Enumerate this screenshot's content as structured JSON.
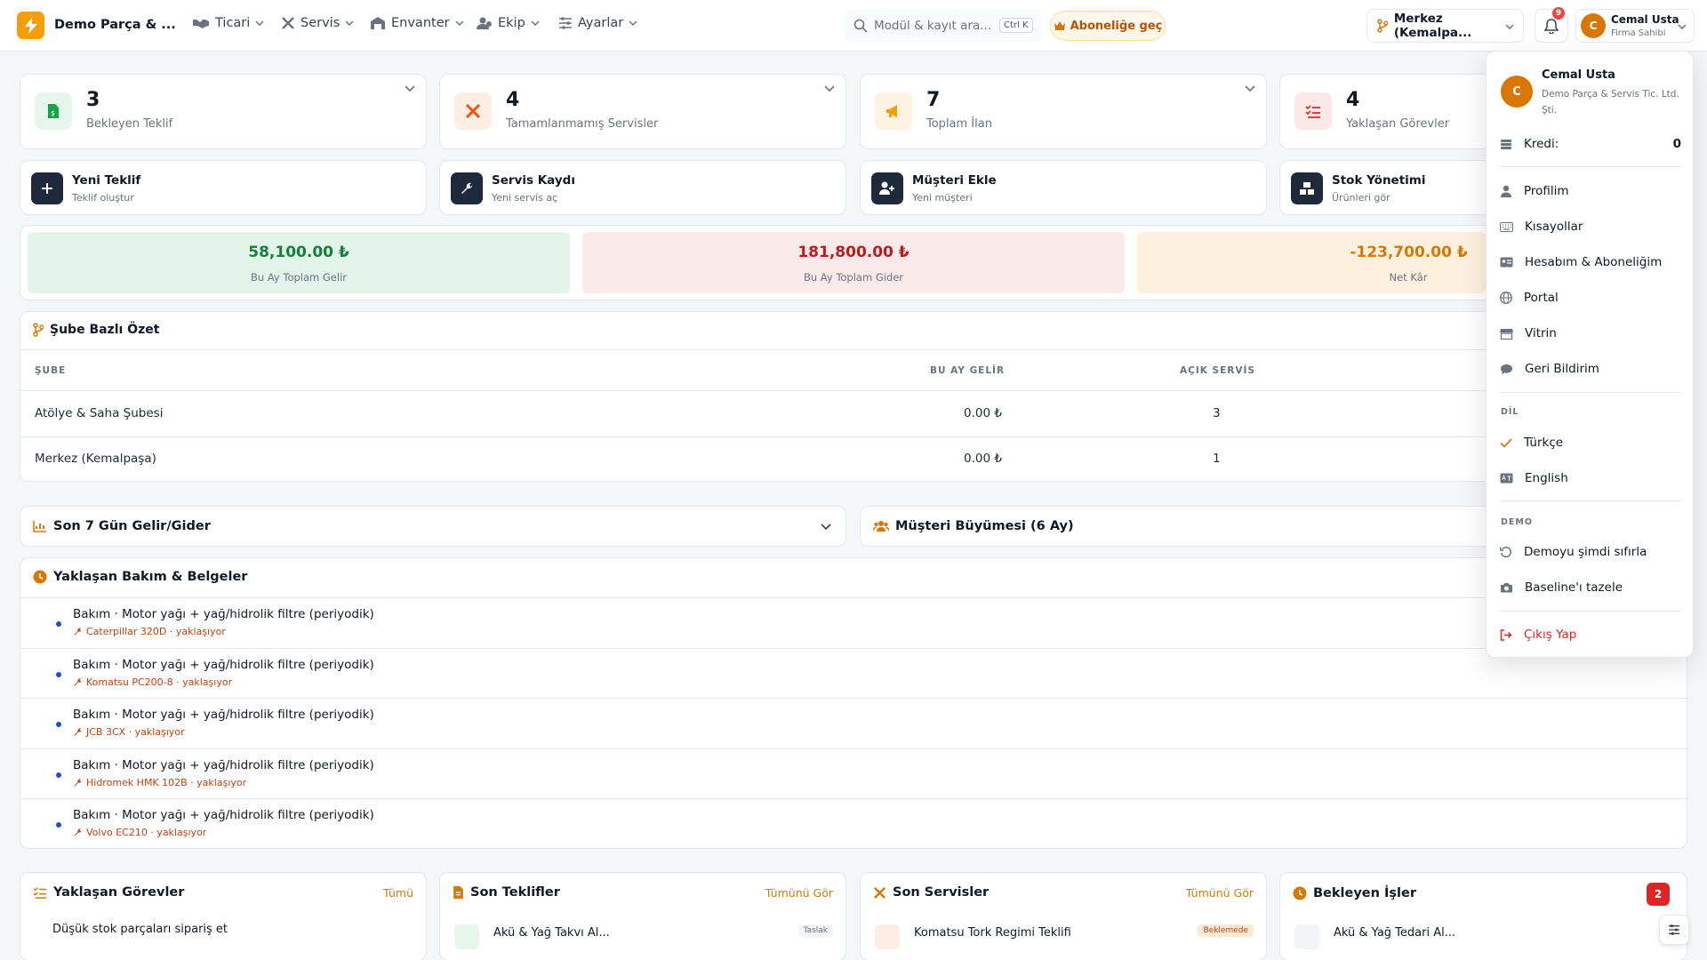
{
  "brand": {
    "name": "Demo Parça & ..."
  },
  "nav": [
    {
      "label": "Ticari",
      "icon": "handshake-icon"
    },
    {
      "label": "Servis",
      "icon": "tools-icon"
    },
    {
      "label": "Envanter",
      "icon": "warehouse-icon"
    },
    {
      "label": "Ekip",
      "icon": "users-icon"
    },
    {
      "label": "Ayarlar",
      "icon": "sliders-icon"
    }
  ],
  "search": {
    "placeholder": "Modül & kayıt ara...",
    "shortcut": "Ctrl K"
  },
  "subscribe": {
    "label": "Aboneliğe geç"
  },
  "branch_selector": {
    "label": "Merkez (Kemalpa..."
  },
  "notifications": {
    "count": "9"
  },
  "user": {
    "initial": "C",
    "name": "Cemal Usta",
    "role": "Firma Sahibi"
  },
  "stats": [
    {
      "value": "3",
      "label": "Bekleyen Teklif",
      "color": "#16a34a",
      "bg": "#e7f6ec"
    },
    {
      "value": "4",
      "label": "Tamamlanmamış Servisler",
      "color": "#ea580c",
      "bg": "#fdeee3"
    },
    {
      "value": "7",
      "label": "Toplam İlan",
      "color": "#f59e0b",
      "bg": "#fef3e0"
    },
    {
      "value": "4",
      "label": "Yaklaşan Görevler",
      "color": "#dc2626",
      "bg": "#fde8e8"
    }
  ],
  "quick_actions": [
    {
      "title": "Yeni Teklif",
      "subtitle": "Teklif oluştur",
      "icon": "plus-icon"
    },
    {
      "title": "Servis Kaydı",
      "subtitle": "Yeni servis aç",
      "icon": "wrench-icon"
    },
    {
      "title": "Müşteri Ekle",
      "subtitle": "Yeni müşteri",
      "icon": "user-plus-icon"
    },
    {
      "title": "Stok Yönetimi",
      "subtitle": "Ürünleri gör",
      "icon": "boxes-icon"
    }
  ],
  "finance": [
    {
      "amount": "58,100.00 ₺",
      "label": "Bu Ay Toplam Gelir",
      "color": "#15803d",
      "bg": "#e3f4ea"
    },
    {
      "amount": "181,800.00 ₺",
      "label": "Bu Ay Toplam Gider",
      "color": "#b91c1c",
      "bg": "#fbeaea"
    },
    {
      "amount": "-123,700.00 ₺",
      "label": "Net Kâr",
      "color": "#d97706",
      "bg": "#fdf1dd"
    }
  ],
  "branch_summary": {
    "title": "Şube Bazlı Özet",
    "columns": [
      "ŞUBE",
      "BU AY GELİR",
      "AÇIK SERVİS"
    ],
    "rows": [
      {
        "name": "Atölye & Saha Şubesi",
        "income": "0.00 ₺",
        "open": "3"
      },
      {
        "name": "Merkez (Kemalpaşa)",
        "income": "0.00 ₺",
        "open": "1"
      }
    ]
  },
  "panels": {
    "income_expense": "Son 7 Gün Gelir/Gider",
    "customer_growth": "Müşteri Büyümesi (6 Ay)"
  },
  "maintenance": {
    "title": "Yaklaşan Bakım & Belgeler",
    "items": [
      {
        "title": "Bakım · Motor yağı + yağ/hidrolik filtre (periyodik)",
        "sub": "Caterpillar 320D · yaklaşıyor"
      },
      {
        "title": "Bakım · Motor yağı + yağ/hidrolik filtre (periyodik)",
        "sub": "Komatsu PC200-8 · yaklaşıyor"
      },
      {
        "title": "Bakım · Motor yağı + yağ/hidrolik filtre (periyodik)",
        "sub": "JCB 3CX · yaklaşıyor"
      },
      {
        "title": "Bakım · Motor yağı + yağ/hidrolik filtre (periyodik)",
        "sub": "Hidromek HMK 102B · yaklaşıyor"
      },
      {
        "title": "Bakım · Motor yağı + yağ/hidrolik filtre (periyodik)",
        "sub": "Volvo EC210 · yaklaşıyor"
      }
    ]
  },
  "bottom_cards": [
    {
      "title": "Yaklaşan Görevler",
      "link": "Tümü",
      "peek": "Düşük stok parçaları sipariş et"
    },
    {
      "title": "Son Teklifler",
      "link": "Tümünü Gör",
      "peek": "Akü & Yağ Takvı Al...",
      "badge": "Taslak"
    },
    {
      "title": "Son Servisler",
      "link": "Tümünü Gör",
      "peek": "Komatsu Tork Regimi Teklifi",
      "badge": "Beklemede"
    },
    {
      "title": "Bekleyen İşler",
      "count": "2",
      "peek": "Akü & Yağ Tedari Al..."
    }
  ],
  "user_menu": {
    "name": "Cemal Usta",
    "company": "Demo Parça & Servis Tic. Ltd. Şti.",
    "credit_label": "Kredi:",
    "credit_value": "0",
    "items": [
      {
        "label": "Profilim",
        "icon": "user-icon"
      },
      {
        "label": "Kısayollar",
        "icon": "keyboard-icon"
      },
      {
        "label": "Hesabım & Aboneliğim",
        "icon": "id-card-icon"
      },
      {
        "label": "Portal",
        "icon": "globe-icon"
      },
      {
        "label": "Vitrin",
        "icon": "store-icon"
      },
      {
        "label": "Geri Bildirim",
        "icon": "comment-icon"
      }
    ],
    "lang_header": "DİL",
    "languages": [
      {
        "label": "Türkçe",
        "icon": "check-icon"
      },
      {
        "label": "English",
        "icon": "language-icon"
      }
    ],
    "demo_header": "DEMO",
    "demo_items": [
      {
        "label": "Demoyu şimdi sıfırla",
        "icon": "reset-icon"
      },
      {
        "label": "Baseline'ı tazele",
        "icon": "camera-icon"
      }
    ],
    "logout": "Çıkış Yap"
  }
}
